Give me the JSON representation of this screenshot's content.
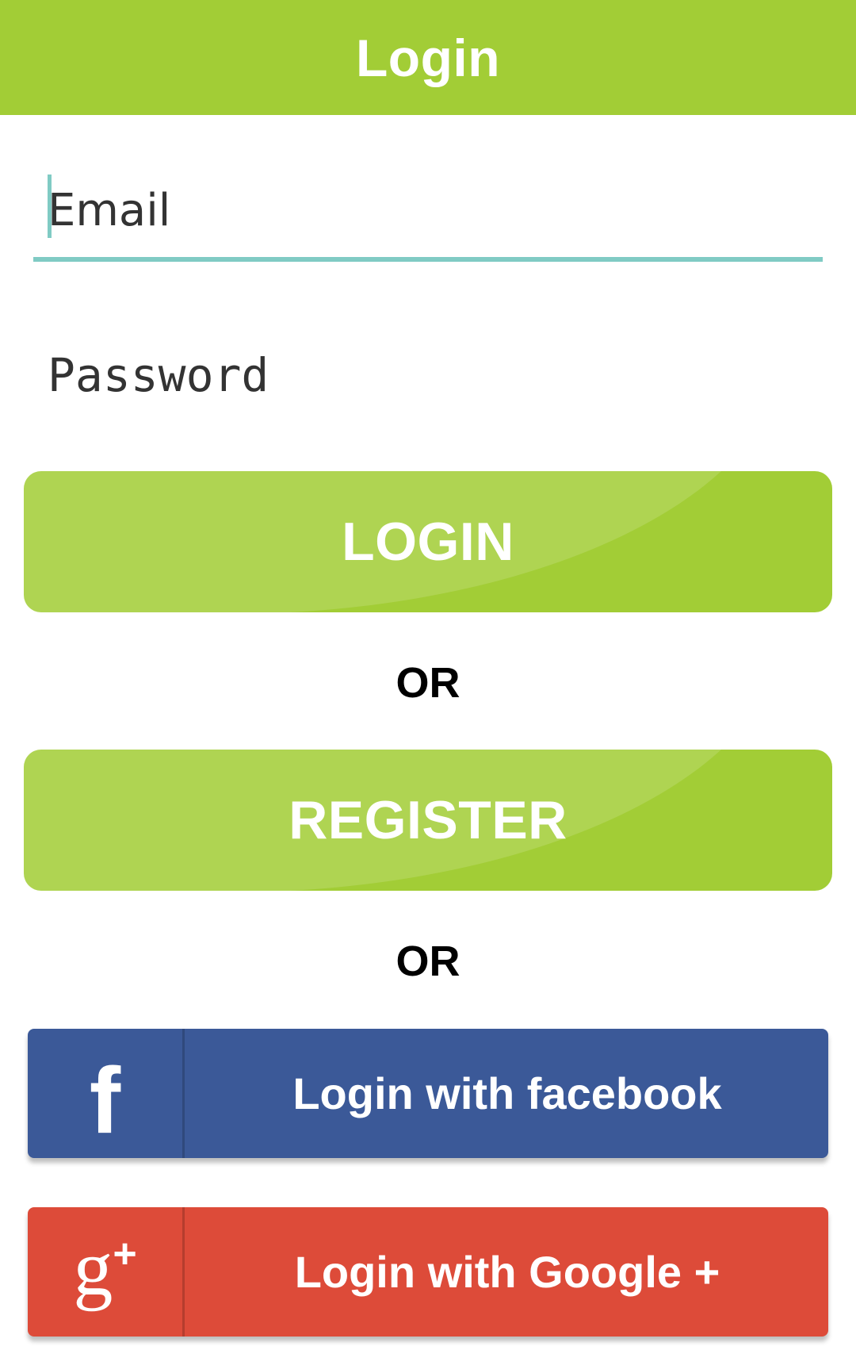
{
  "toolbar": {
    "title": "Login",
    "color": "#a2cd36"
  },
  "form": {
    "email_placeholder": "Email",
    "password_placeholder": "Password",
    "accent_color": "#80cbc4"
  },
  "buttons": {
    "login_label": "LOGIN",
    "register_label": "REGISTER",
    "or_label": "OR"
  },
  "social": {
    "facebook": {
      "label": "Login with facebook",
      "icon": "facebook-icon",
      "glyph": "f",
      "color": "#3b5998"
    },
    "google": {
      "label": "Login with Google +",
      "icon": "google-plus-icon",
      "glyph": "g",
      "glyph_sup": "+",
      "color": "#dd4b39"
    }
  }
}
